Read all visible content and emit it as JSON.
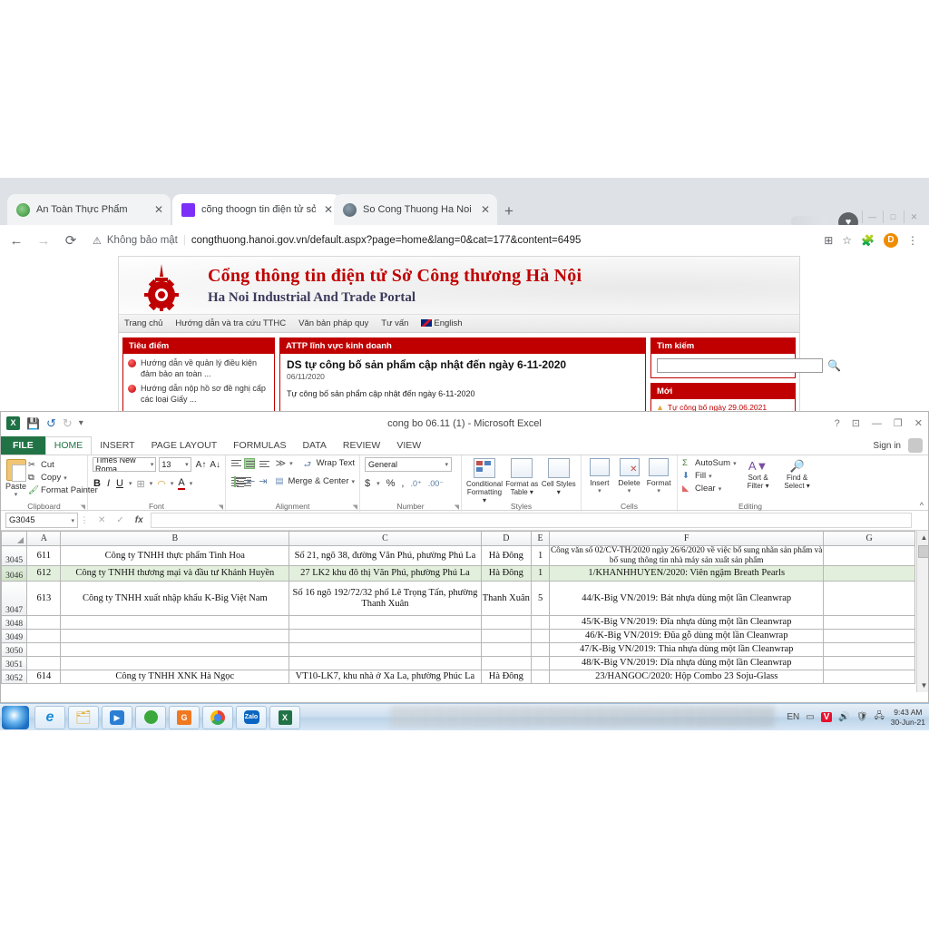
{
  "browser": {
    "tabs": [
      {
        "title": "An Toàn Thực Phẩm",
        "favicon": "leaf-icon",
        "active": false
      },
      {
        "title": "cõng thoogn tin điện tử sở công",
        "favicon": "w-icon",
        "active": true
      },
      {
        "title": "So Cong Thuong Ha Noi",
        "favicon": "globe-icon",
        "active": false
      }
    ],
    "new_tab_label": "+",
    "close_label": "✕",
    "nav": {
      "back": "←",
      "forward": "→",
      "reload": "⟳"
    },
    "security_label": "Không bảo mật",
    "security_icon": "warning-triangle-icon",
    "url": "congthuong.hanoi.gov.vn/default.aspx?page=home&lang=0&cat=177&content=6495",
    "toolbar_icons": {
      "qr": "qr-code-icon",
      "bookmark": "star-icon",
      "extensions": "puzzle-icon",
      "menu": "kebab-menu-icon"
    },
    "profile_initial": "D",
    "window_controls": [
      "—",
      "□",
      "✕"
    ]
  },
  "site": {
    "title_vi": "Cổng thông tin điện tử Sở Công thương Hà Nội",
    "title_en": "Ha Noi Industrial And Trade Portal",
    "logo_name": "hanoi-industry-trade-logo",
    "nav": [
      {
        "label": "Trang chủ"
      },
      {
        "label": "Hướng dẫn và tra cứu TTHC"
      },
      {
        "label": "Văn bản pháp quy"
      },
      {
        "label": "Tư vấn"
      },
      {
        "label": "English",
        "icon": "uk-flag-icon"
      }
    ],
    "left_panel": {
      "header": "Tiêu điểm",
      "items": [
        "Hướng dẫn về quản lý điều kiện đảm bảo an toàn ...",
        "Hướng dẫn nộp hồ sơ đề nghị cấp các loại Giấy ..."
      ]
    },
    "mid_panel": {
      "header": "ATTP lĩnh vực kinh doanh",
      "title": "DS tự công bố sản phẩm cập nhật đến ngày 6-11-2020",
      "date": "06/11/2020",
      "desc": "Tự công bố sản phẩm cập nhật đến ngày 6-11-2020"
    },
    "right_panel": {
      "search_header": "Tìm kiếm",
      "search_value": "",
      "search_icon": "magnifier-icon",
      "new_header": "Mới",
      "new_items": [
        "Tự công bố ngày 29.06.2021"
      ]
    }
  },
  "excel": {
    "document_title": "cong bo 06.11 (1) - Microsoft Excel",
    "app_icon": "excel-icon",
    "quick_access": [
      "save-icon",
      "undo-icon",
      "redo-icon",
      "customize-qat-icon"
    ],
    "window_controls": [
      "?",
      "⊡",
      "—",
      "❐",
      "✕"
    ],
    "sign_in": "Sign in",
    "tabs": [
      {
        "label": "FILE",
        "type": "file"
      },
      {
        "label": "HOME",
        "type": "selected"
      },
      {
        "label": "INSERT",
        "type": "normal"
      },
      {
        "label": "PAGE LAYOUT",
        "type": "normal"
      },
      {
        "label": "FORMULAS",
        "type": "normal"
      },
      {
        "label": "DATA",
        "type": "normal"
      },
      {
        "label": "REVIEW",
        "type": "normal"
      },
      {
        "label": "VIEW",
        "type": "normal"
      }
    ],
    "ribbon": {
      "clipboard": {
        "group_label": "Clipboard",
        "paste": "Paste",
        "cut": "Cut",
        "copy": "Copy",
        "format_painter": "Format Painter"
      },
      "font": {
        "group_label": "Font",
        "font_name": "Times New Roma",
        "font_size": "13",
        "grow": "A",
        "shrink": "A",
        "bold": "B",
        "italic": "I",
        "underline": "U",
        "borders": "borders-icon",
        "fill_color": "fill-color-icon",
        "font_color": "A"
      },
      "alignment": {
        "group_label": "Alignment",
        "wrap_text": "Wrap Text",
        "merge_center": "Merge & Center"
      },
      "number": {
        "group_label": "Number",
        "format": "General",
        "currency": "$",
        "percent": "%",
        "comma": ","
      },
      "styles": {
        "group_label": "Styles",
        "conditional_formatting": "Conditional Formatting",
        "format_as_table": "Format as Table",
        "cell_styles": "Cell Styles"
      },
      "cells": {
        "group_label": "Cells",
        "insert": "Insert",
        "delete": "Delete",
        "format": "Format"
      },
      "editing": {
        "group_label": "Editing",
        "autosum": "AutoSum",
        "fill": "Fill",
        "clear": "Clear",
        "sort_filter": "Sort & Filter",
        "find_select": "Find & Select"
      },
      "collapse_label": "^"
    },
    "formula_bar": {
      "name_box": "G3045",
      "cancel": "✕",
      "enter": "✓",
      "fx": "fx",
      "value": ""
    },
    "sheet": {
      "columns": [
        "A",
        "B",
        "C",
        "D",
        "E",
        "F",
        "G"
      ],
      "rows": [
        {
          "num": "3045",
          "selected": false,
          "cells": {
            "A": "611",
            "B": "Công ty TNHH thực phẩm Tinh Hoa",
            "C": "Số 21, ngõ 38, đường Văn Phú, phường Phú La",
            "D": "Hà Đông",
            "E": "1",
            "F": "Công văn số 02/CV-TH/2020 ngày 26/6/2020 về việc bổ sung nhãn sản phẩm và bổ sung thông tin nhà máy sản xuất sản phẩm",
            "G": ""
          }
        },
        {
          "num": "3046",
          "selected": true,
          "cells": {
            "A": "612",
            "B": "Công ty TNHH thương mại và đầu tư Khánh Huyền",
            "C": "27 LK2 khu đô thị Văn Phú, phường Phú La",
            "D": "Hà Đông",
            "E": "1",
            "F": "1/KHANHHUYEN/2020: Viên ngậm Breath Pearls",
            "G": ""
          }
        },
        {
          "num": "3047",
          "selected": false,
          "cells": {
            "A": "613",
            "B": "Công ty TNHH xuất nhập khẩu K-Big Việt Nam",
            "C": "Số 16 ngõ 192/72/32 phố Lê Trọng Tấn, phường Thanh Xuân",
            "D": "Thanh Xuân",
            "E": "5",
            "F": "44/K-Big VN/2019: Bát nhựa dùng một lần Cleanwrap",
            "G": ""
          }
        },
        {
          "num": "3048",
          "selected": false,
          "cells": {
            "A": "",
            "B": "",
            "C": "",
            "D": "",
            "E": "",
            "F": "45/K-Big VN/2019: Đĩa nhựa dùng một lần Cleanwrap",
            "G": ""
          }
        },
        {
          "num": "3049",
          "selected": false,
          "cells": {
            "A": "",
            "B": "",
            "C": "",
            "D": "",
            "E": "",
            "F": "46/K-Big VN/2019: Đũa gỗ dùng một lần Cleanwrap",
            "G": ""
          }
        },
        {
          "num": "3050",
          "selected": false,
          "cells": {
            "A": "",
            "B": "",
            "C": "",
            "D": "",
            "E": "",
            "F": "47/K-Big VN/2019: Thìa nhựa dùng một lần Cleanwrap",
            "G": ""
          }
        },
        {
          "num": "3051",
          "selected": false,
          "cells": {
            "A": "",
            "B": "",
            "C": "",
            "D": "",
            "E": "",
            "F": "48/K-Big VN/2019: Dĩa nhựa dùng một lần Cleanwrap",
            "G": ""
          }
        },
        {
          "num": "3052",
          "selected": false,
          "cells": {
            "A": "614",
            "B": "Công ty TNHH XNK Hà Ngọc",
            "C": "VT10-LK7, khu nhà ở Xa La, phường Phúc La",
            "D": "Hà Đông",
            "E": "",
            "F": "23/HANGOC/2020: Hộp Combo 23 Soju-Glass",
            "G": ""
          }
        }
      ]
    }
  },
  "taskbar": {
    "start_icon": "windows-start-icon",
    "items": [
      {
        "name": "internet-explorer-icon"
      },
      {
        "name": "file-explorer-icon"
      },
      {
        "name": "media-player-icon"
      },
      {
        "name": "unikey-icon"
      },
      {
        "name": "pdf-reader-icon"
      },
      {
        "name": "google-chrome-icon"
      },
      {
        "name": "zalo-icon"
      },
      {
        "name": "microsoft-excel-icon"
      }
    ],
    "tray": {
      "language": "EN",
      "icons": [
        "battery-icon",
        "unikey-v-icon",
        "volume-icon",
        "antivirus-icon",
        "network-icon"
      ],
      "time": "9:43 AM",
      "date": "30-Jun-21"
    }
  },
  "colors": {
    "site_red": "#c00000",
    "excel_green": "#217346",
    "selection_green": "#e3efdd",
    "chrome_grey": "#dee1e6"
  }
}
